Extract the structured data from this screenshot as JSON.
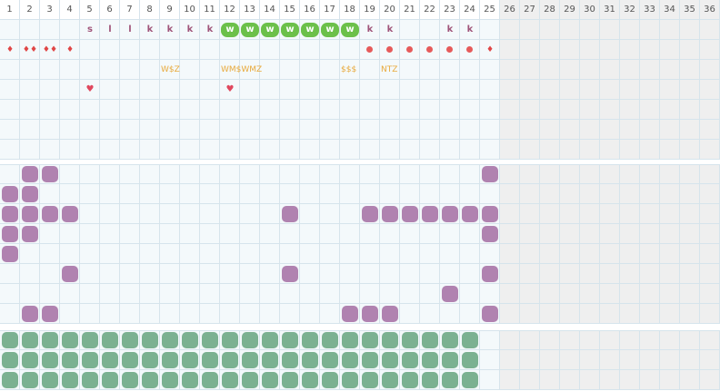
{
  "column_headers": [
    "1",
    "2",
    "3",
    "4",
    "5",
    "6",
    "7",
    "8",
    "9",
    "10",
    "11",
    "12",
    "13",
    "14",
    "15",
    "16",
    "17",
    "18",
    "19",
    "20",
    "21",
    "22",
    "23",
    "24",
    "25",
    "26",
    "27",
    "28",
    "29",
    "30",
    "31",
    "32",
    "33",
    "34",
    "35",
    "36"
  ],
  "active_columns": 25,
  "colors": {
    "grid_line": "#d6e4ec",
    "inactive_fill": "#efefef",
    "purple_block": "#b082b0",
    "green_block": "#7bb191",
    "w_badge": "#6cc04a",
    "letter": "#a0557a",
    "marker_red": "#e65a5a",
    "annotation": "#e8a93b"
  },
  "top_section": {
    "letters": [
      {
        "col": 5,
        "text": "s"
      },
      {
        "col": 6,
        "text": "l"
      },
      {
        "col": 7,
        "text": "l"
      },
      {
        "col": 8,
        "text": "k"
      },
      {
        "col": 9,
        "text": "k"
      },
      {
        "col": 10,
        "text": "k"
      },
      {
        "col": 11,
        "text": "k"
      },
      {
        "col": 19,
        "text": "k"
      },
      {
        "col": 20,
        "text": "k"
      },
      {
        "col": 23,
        "text": "k"
      },
      {
        "col": 24,
        "text": "k"
      }
    ],
    "w_badges": [
      {
        "col": 12,
        "text": "w"
      },
      {
        "col": 13,
        "text": "w"
      },
      {
        "col": 14,
        "text": "w"
      },
      {
        "col": 15,
        "text": "w"
      },
      {
        "col": 16,
        "text": "w"
      },
      {
        "col": 17,
        "text": "w"
      },
      {
        "col": 18,
        "text": "w"
      }
    ],
    "drops": [
      {
        "col": 1,
        "text": "♦"
      },
      {
        "col": 2,
        "text": "♦♦"
      },
      {
        "col": 3,
        "text": "♦♦"
      },
      {
        "col": 4,
        "text": "♦"
      },
      {
        "col": 25,
        "text": "♦"
      }
    ],
    "dots_cols": [
      19,
      20,
      21,
      22,
      23,
      24
    ],
    "annotations": [
      {
        "col": 9,
        "text": "W$Z"
      },
      {
        "col": 12,
        "text": "WM$WMZ"
      },
      {
        "col": 18,
        "text": "$$$"
      },
      {
        "col": 20,
        "text": "NTZ"
      }
    ],
    "hearts": [
      {
        "col": 5,
        "text": "♥"
      },
      {
        "col": 12,
        "text": "♥"
      }
    ]
  },
  "middle_section": {
    "rows": [
      [
        2,
        3,
        25
      ],
      [
        1,
        2
      ],
      [
        1,
        2,
        3,
        4,
        15,
        19,
        20,
        21,
        22,
        23,
        24,
        25
      ],
      [
        1,
        2,
        25
      ],
      [
        1
      ],
      [
        4,
        15,
        25
      ],
      [
        23
      ],
      [
        2,
        3,
        18,
        19,
        20,
        25
      ]
    ]
  },
  "bottom_section": {
    "rows": 3,
    "cols_from": 1,
    "cols_to": 24
  }
}
